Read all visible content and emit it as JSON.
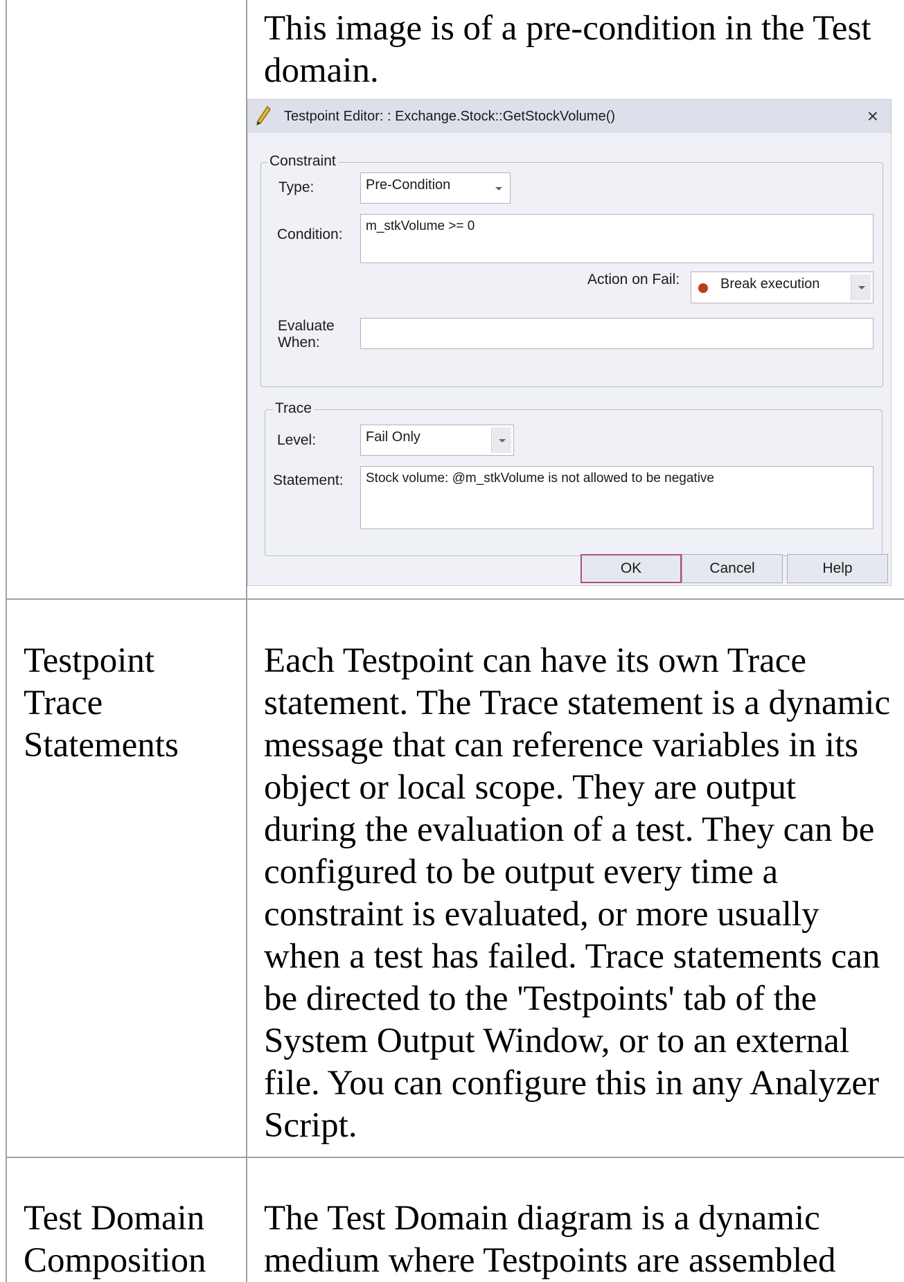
{
  "rows": [
    {
      "term": "",
      "text": "This image is of a pre-condition in the Test domain."
    },
    {
      "term": "Testpoint Trace Statements",
      "text": "Each Testpoint can have its own Trace statement. The Trace statement is a dynamic message that can reference variables in its object or local scope. They are output during the evaluation of a test. They can be configured to be output every time a constraint is evaluated, or more usually when a test has failed. Trace statements can be directed to the 'Testpoints' tab of the System Output Window, or to an external file. You can configure this in any Analyzer Script."
    },
    {
      "term": "Test Domain Composition",
      "text": "The Test Domain diagram is a dynamic medium where Testpoints are assembled"
    }
  ],
  "dialog": {
    "title": "Testpoint Editor: : Exchange.Stock::GetStockVolume()",
    "close": "×",
    "constraint": {
      "group_label": "Constraint",
      "type_label": "Type:",
      "type_value": "Pre-Condition",
      "condition_label": "Condition:",
      "condition_value": "m_stkVolume >= 0",
      "action_label": "Action on Fail:",
      "action_value": "Break execution",
      "evaluate_label_1": "Evaluate",
      "evaluate_label_2": "When:",
      "evaluate_value": ""
    },
    "trace": {
      "group_label": "Trace",
      "level_label": "Level:",
      "level_value": "Fail Only",
      "statement_label": "Statement:",
      "statement_value": "Stock volume: @m_stkVolume is not allowed to be negative"
    },
    "buttons": {
      "ok": "OK",
      "cancel": "Cancel",
      "help": "Help"
    },
    "colors": {
      "action_icon": "#c0391c",
      "ok_border": "#b04c86"
    }
  }
}
